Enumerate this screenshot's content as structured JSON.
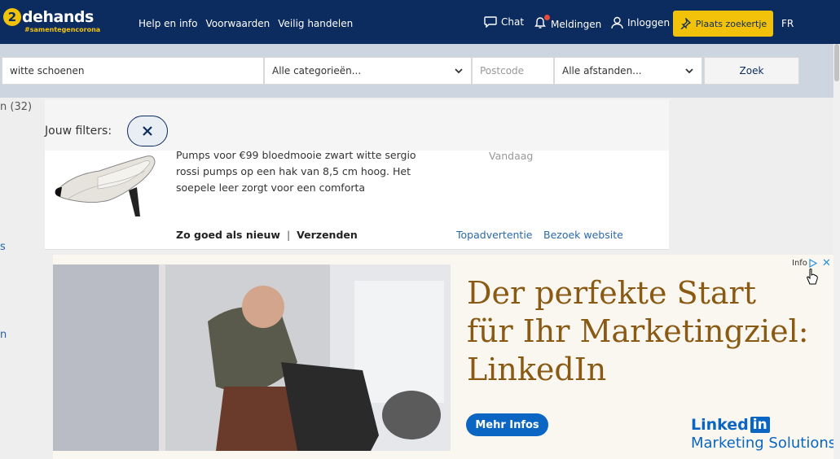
{
  "header": {
    "logo_digit": "2",
    "logo_word": "dehands",
    "logo_tagline": "#samentegencorona",
    "nav": [
      "Help en info",
      "Voorwaarden",
      "Veilig handelen"
    ],
    "chat_label": "Chat",
    "notifications_label": "Meldingen",
    "login_label": "Inloggen",
    "place_ad_label": "Plaats zoekertje",
    "language": "FR"
  },
  "search": {
    "query": "witte schoenen",
    "category": "Alle categorieën...",
    "postcode_placeholder": "Postcode",
    "distance": "Alle afstanden...",
    "submit_label": "Zoek"
  },
  "sidebar": {
    "count_fragment": "n (32)",
    "frag_s": "s",
    "frag_n": "n"
  },
  "filters": {
    "label": "Jouw filters:"
  },
  "listing": {
    "description": "Pumps voor €99 bloedmooie zwart witte sergio rossi pumps op een hak van 8,5 cm hoog. Het soepele leer zorgt voor een comforta",
    "date": "Vandaag",
    "condition": "Zo goed als nieuw",
    "separator": "|",
    "shipping": "Verzenden",
    "top_ad_label": "Topadvertentie",
    "visit_website_label": "Bezoek website"
  },
  "ad": {
    "headline": "Der perfekte Start für Ihr Marketingziel: LinkedIn",
    "cta": "Mehr Infos",
    "brand_word": "Linked",
    "brand_box": "in",
    "brand_sub": "Marketing Solutions",
    "info_label": "Info",
    "close_glyph": "✕"
  },
  "colors": {
    "header_bg": "#0c2b5e",
    "accent_yellow": "#f2c20b",
    "link_blue": "#2b6aa8",
    "linkedin_blue": "#0a66c2"
  }
}
